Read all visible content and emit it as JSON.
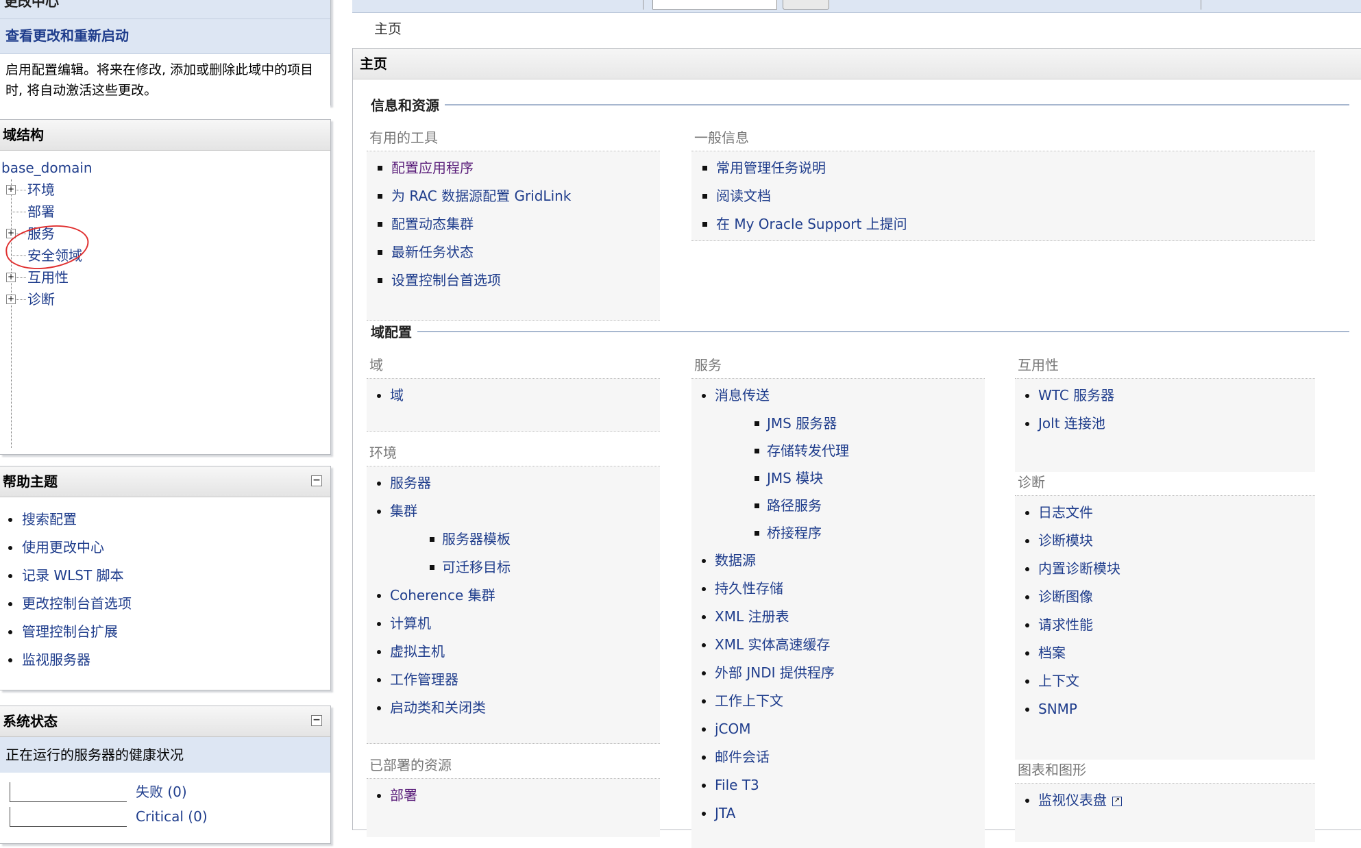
{
  "change_center": {
    "header": "更改中心",
    "link": "查看更改和重新启动",
    "description": "启用配置编辑。将来在修改, 添加或删除此域中的项目时, 将自动激活这些更改。"
  },
  "domain_structure": {
    "title": "域结构",
    "root": "base_domain",
    "nodes": [
      "环境",
      "部署",
      "服务",
      "安全领域",
      "互用性",
      "诊断"
    ]
  },
  "help_topics": {
    "title": "帮助主题",
    "items": [
      "搜索配置",
      "使用更改中心",
      "记录 WLST 脚本",
      "更改控制台首选项",
      "管理控制台扩展",
      "监视服务器"
    ]
  },
  "system_status": {
    "title": "系统状态",
    "subtitle": "正在运行的服务器的健康状况",
    "rows": [
      "失败 (0)",
      "Critical (0)"
    ]
  },
  "breadcrumb": "主页",
  "main": {
    "title": "主页",
    "info_section": {
      "title": "信息和资源",
      "tools": {
        "heading": "有用的工具",
        "items": [
          "配置应用程序",
          "为 RAC 数据源配置 GridLink",
          "配置动态集群",
          "最新任务状态",
          "设置控制台首选项"
        ]
      },
      "general": {
        "heading": "一般信息",
        "items": [
          "常用管理任务说明",
          "阅读文档",
          "在 My Oracle Support 上提问"
        ]
      }
    },
    "domain_config": {
      "title": "域配置",
      "domain": {
        "heading": "域",
        "items": [
          "域"
        ]
      },
      "environment": {
        "heading": "环境",
        "items": [
          "服务器",
          "集群",
          "服务器模板",
          "可迁移目标",
          "Coherence 集群",
          "计算机",
          "虚拟主机",
          "工作管理器",
          "启动类和关闭类"
        ]
      },
      "deployed": {
        "heading": "已部署的资源",
        "items": [
          "部署"
        ]
      },
      "services": {
        "heading": "服务",
        "items": [
          "消息传送",
          "JMS 服务器",
          "存储转发代理",
          "JMS 模块",
          "路径服务",
          "桥接程序",
          "数据源",
          "持久性存储",
          "XML 注册表",
          "XML 实体高速缓存",
          "外部 JNDI 提供程序",
          "工作上下文",
          "jCOM",
          "邮件会话",
          "File T3",
          "JTA"
        ]
      },
      "interop": {
        "heading": "互用性",
        "items": [
          "WTC 服务器",
          "Jolt 连接池"
        ]
      },
      "diagnostics": {
        "heading": "诊断",
        "items": [
          "日志文件",
          "诊断模块",
          "内置诊断模块",
          "诊断图像",
          "请求性能",
          "档案",
          "上下文",
          "SNMP"
        ]
      },
      "charts": {
        "heading": "图表和图形",
        "items": [
          "监视仪表盘"
        ]
      }
    }
  },
  "colors": {
    "link": "#1f3d8c",
    "visited": "#5a1e7a",
    "panel_blue": "#dde6f3",
    "annotation": "#e03030"
  }
}
